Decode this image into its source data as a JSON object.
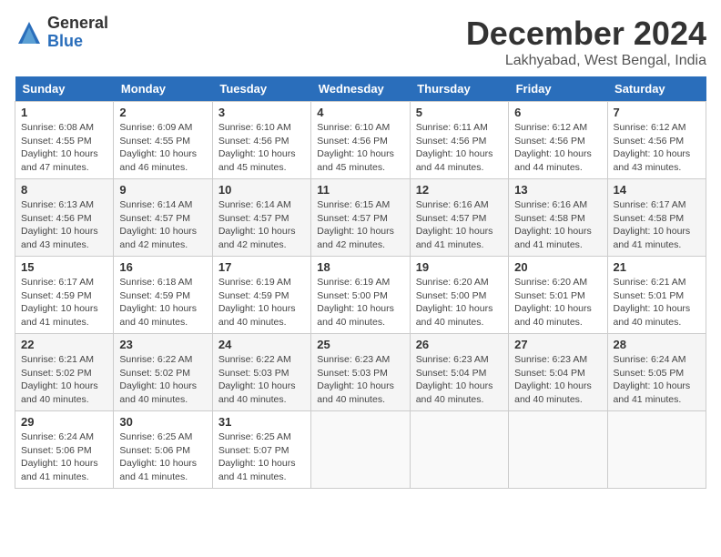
{
  "logo": {
    "general": "General",
    "blue": "Blue"
  },
  "header": {
    "month": "December 2024",
    "location": "Lakhyabad, West Bengal, India"
  },
  "weekdays": [
    "Sunday",
    "Monday",
    "Tuesday",
    "Wednesday",
    "Thursday",
    "Friday",
    "Saturday"
  ],
  "weeks": [
    [
      {
        "day": "1",
        "sunrise": "6:08 AM",
        "sunset": "4:55 PM",
        "daylight": "10 hours and 47 minutes."
      },
      {
        "day": "2",
        "sunrise": "6:09 AM",
        "sunset": "4:55 PM",
        "daylight": "10 hours and 46 minutes."
      },
      {
        "day": "3",
        "sunrise": "6:10 AM",
        "sunset": "4:56 PM",
        "daylight": "10 hours and 45 minutes."
      },
      {
        "day": "4",
        "sunrise": "6:10 AM",
        "sunset": "4:56 PM",
        "daylight": "10 hours and 45 minutes."
      },
      {
        "day": "5",
        "sunrise": "6:11 AM",
        "sunset": "4:56 PM",
        "daylight": "10 hours and 44 minutes."
      },
      {
        "day": "6",
        "sunrise": "6:12 AM",
        "sunset": "4:56 PM",
        "daylight": "10 hours and 44 minutes."
      },
      {
        "day": "7",
        "sunrise": "6:12 AM",
        "sunset": "4:56 PM",
        "daylight": "10 hours and 43 minutes."
      }
    ],
    [
      {
        "day": "8",
        "sunrise": "6:13 AM",
        "sunset": "4:56 PM",
        "daylight": "10 hours and 43 minutes."
      },
      {
        "day": "9",
        "sunrise": "6:14 AM",
        "sunset": "4:57 PM",
        "daylight": "10 hours and 42 minutes."
      },
      {
        "day": "10",
        "sunrise": "6:14 AM",
        "sunset": "4:57 PM",
        "daylight": "10 hours and 42 minutes."
      },
      {
        "day": "11",
        "sunrise": "6:15 AM",
        "sunset": "4:57 PM",
        "daylight": "10 hours and 42 minutes."
      },
      {
        "day": "12",
        "sunrise": "6:16 AM",
        "sunset": "4:57 PM",
        "daylight": "10 hours and 41 minutes."
      },
      {
        "day": "13",
        "sunrise": "6:16 AM",
        "sunset": "4:58 PM",
        "daylight": "10 hours and 41 minutes."
      },
      {
        "day": "14",
        "sunrise": "6:17 AM",
        "sunset": "4:58 PM",
        "daylight": "10 hours and 41 minutes."
      }
    ],
    [
      {
        "day": "15",
        "sunrise": "6:17 AM",
        "sunset": "4:59 PM",
        "daylight": "10 hours and 41 minutes."
      },
      {
        "day": "16",
        "sunrise": "6:18 AM",
        "sunset": "4:59 PM",
        "daylight": "10 hours and 40 minutes."
      },
      {
        "day": "17",
        "sunrise": "6:19 AM",
        "sunset": "4:59 PM",
        "daylight": "10 hours and 40 minutes."
      },
      {
        "day": "18",
        "sunrise": "6:19 AM",
        "sunset": "5:00 PM",
        "daylight": "10 hours and 40 minutes."
      },
      {
        "day": "19",
        "sunrise": "6:20 AM",
        "sunset": "5:00 PM",
        "daylight": "10 hours and 40 minutes."
      },
      {
        "day": "20",
        "sunrise": "6:20 AM",
        "sunset": "5:01 PM",
        "daylight": "10 hours and 40 minutes."
      },
      {
        "day": "21",
        "sunrise": "6:21 AM",
        "sunset": "5:01 PM",
        "daylight": "10 hours and 40 minutes."
      }
    ],
    [
      {
        "day": "22",
        "sunrise": "6:21 AM",
        "sunset": "5:02 PM",
        "daylight": "10 hours and 40 minutes."
      },
      {
        "day": "23",
        "sunrise": "6:22 AM",
        "sunset": "5:02 PM",
        "daylight": "10 hours and 40 minutes."
      },
      {
        "day": "24",
        "sunrise": "6:22 AM",
        "sunset": "5:03 PM",
        "daylight": "10 hours and 40 minutes."
      },
      {
        "day": "25",
        "sunrise": "6:23 AM",
        "sunset": "5:03 PM",
        "daylight": "10 hours and 40 minutes."
      },
      {
        "day": "26",
        "sunrise": "6:23 AM",
        "sunset": "5:04 PM",
        "daylight": "10 hours and 40 minutes."
      },
      {
        "day": "27",
        "sunrise": "6:23 AM",
        "sunset": "5:04 PM",
        "daylight": "10 hours and 40 minutes."
      },
      {
        "day": "28",
        "sunrise": "6:24 AM",
        "sunset": "5:05 PM",
        "daylight": "10 hours and 41 minutes."
      }
    ],
    [
      {
        "day": "29",
        "sunrise": "6:24 AM",
        "sunset": "5:06 PM",
        "daylight": "10 hours and 41 minutes."
      },
      {
        "day": "30",
        "sunrise": "6:25 AM",
        "sunset": "5:06 PM",
        "daylight": "10 hours and 41 minutes."
      },
      {
        "day": "31",
        "sunrise": "6:25 AM",
        "sunset": "5:07 PM",
        "daylight": "10 hours and 41 minutes."
      },
      null,
      null,
      null,
      null
    ]
  ]
}
